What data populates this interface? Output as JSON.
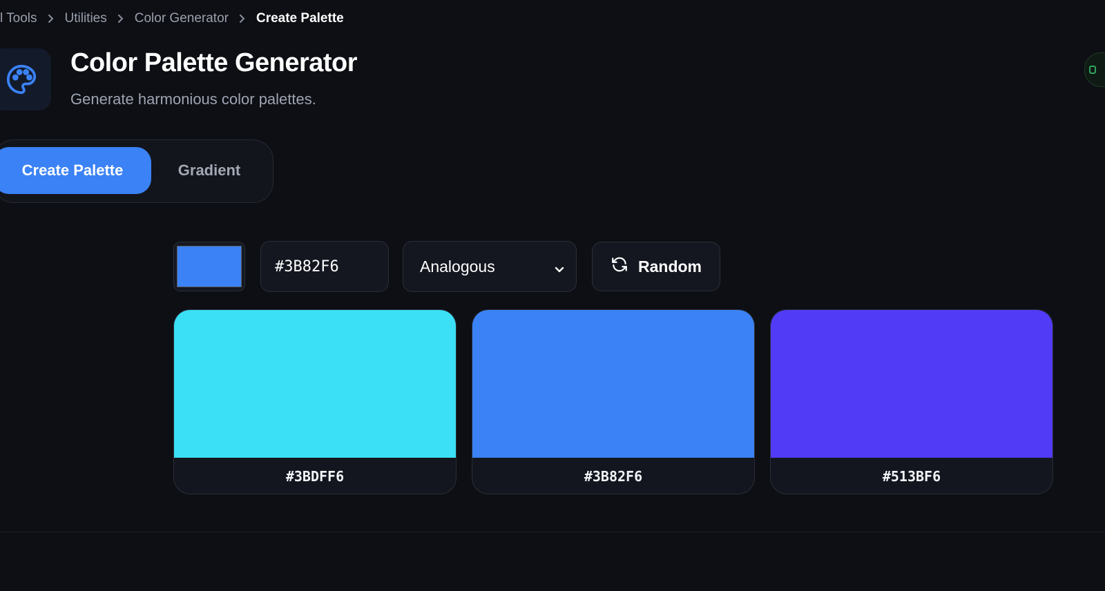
{
  "breadcrumb": {
    "items": [
      "l Tools",
      "Utilities",
      "Color Generator"
    ],
    "current": "Create Palette"
  },
  "header": {
    "icon": "palette-icon",
    "title": "Color Palette Generator",
    "subtitle": "Generate harmonious color palettes."
  },
  "tabs": [
    {
      "label": "Create Palette",
      "active": true
    },
    {
      "label": "Gradient",
      "active": false
    }
  ],
  "controls": {
    "base_color": "#3B82F6",
    "hex_value": "#3B82F6",
    "scheme": "Analogous",
    "random_label": "Random",
    "random_icon": "refresh-icon"
  },
  "palette": [
    {
      "hex": "#3BDFF6"
    },
    {
      "hex": "#3B82F6"
    },
    {
      "hex": "#513BF6"
    }
  ],
  "colors": {
    "accent": "#3b82f6",
    "background": "#0d0f14"
  }
}
